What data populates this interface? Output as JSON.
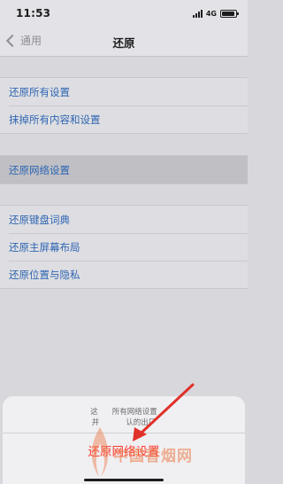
{
  "status": {
    "time": "11:53",
    "network": "4G",
    "battery_fraction": 0.9
  },
  "nav": {
    "back_label": "通用",
    "title": "还原"
  },
  "group1": [
    "还原所有设置",
    "抹掉所有内容和设置"
  ],
  "group2": [
    "还原网络设置"
  ],
  "group3": [
    "还原键盘词典",
    "还原主屏幕布局",
    "还原位置与隐私"
  ],
  "sheet": {
    "message_line1": "这",
    "message_line1_tail": "所有网络设置",
    "message_line2": "并",
    "message_line2_mid": "认的出厂",
    "action": "还原网络设置"
  },
  "watermark": {
    "text": "中国香烟网",
    "color": "#eb7846"
  },
  "colors": {
    "link": "#2f66b3",
    "destructive": "#ff3b30",
    "background": "#d7d7dc"
  }
}
